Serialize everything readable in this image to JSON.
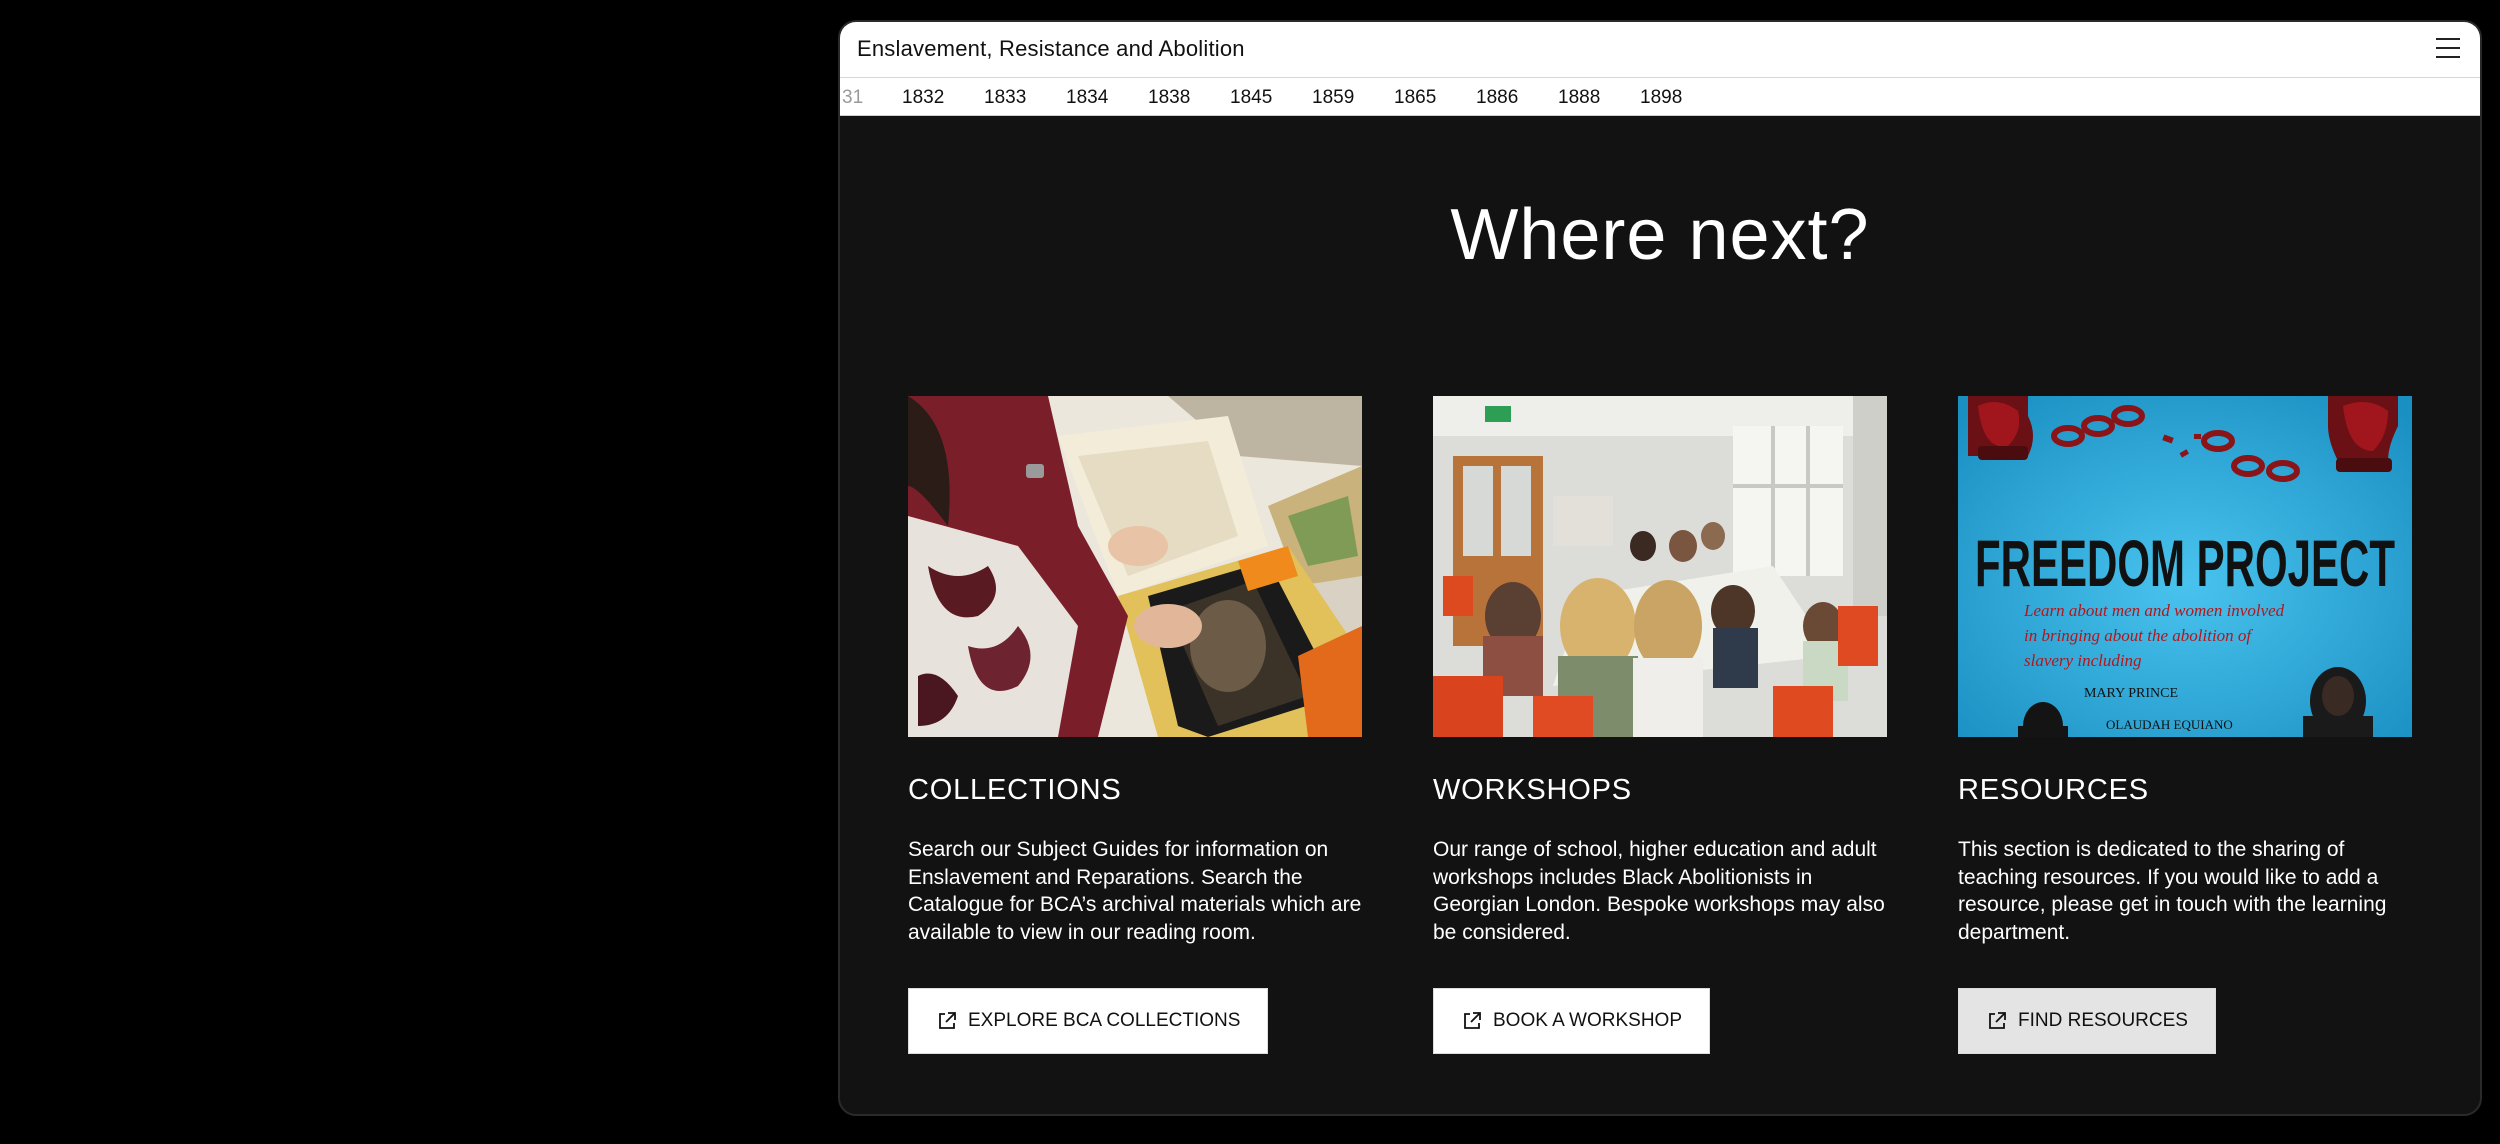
{
  "app": {
    "title": "Enslavement, Resistance and Abolition",
    "menu_icon": "hamburger-menu-icon"
  },
  "timeline": {
    "partial_year": "31",
    "years": [
      "1832",
      "1833",
      "1834",
      "1838",
      "1845",
      "1859",
      "1865",
      "1886",
      "1888",
      "1898"
    ]
  },
  "main": {
    "heading": "Where next?",
    "cards": [
      {
        "title": "COLLECTIONS",
        "text": "Search our Subject Guides for information on Enslavement and Reparations. Search the Catalogue for BCA’s archival materials which are available to view in our reading room.",
        "button_label": "EXPLORE BCA COLLECTIONS",
        "button_icon": "external-link-icon",
        "image_name": "archive-documents-photo"
      },
      {
        "title": "WORKSHOPS",
        "text": "Our range of school, higher education and adult workshops includes Black Abolitionists in Georgian London. Bespoke workshops may also be considered.",
        "button_label": "BOOK A WORKSHOP",
        "button_icon": "external-link-icon",
        "image_name": "workshop-classroom-photo"
      },
      {
        "title": "RESOURCES",
        "text": "This section is dedicated to the sharing of teaching resources. If you would like to add a resource, please get in touch with the learning department.",
        "button_label": "FIND RESOURCES",
        "button_icon": "external-link-icon",
        "image_name": "freedom-project-poster",
        "poster": {
          "headline": "FREEDOM PROJECT",
          "tagline": "Learn about men and women involved in bringing about the abolition of slavery including",
          "name_1": "MARY PRINCE",
          "name_2": "OLAUDAH EQUIANO"
        }
      }
    ]
  },
  "colors": {
    "page_background": "#000000",
    "content_background": "#121212",
    "bar_background": "#ffffff",
    "text_light": "#ffffff",
    "text_dark": "#111111",
    "poster_blue": "#1e9fd2",
    "poster_red": "#b3161b"
  }
}
